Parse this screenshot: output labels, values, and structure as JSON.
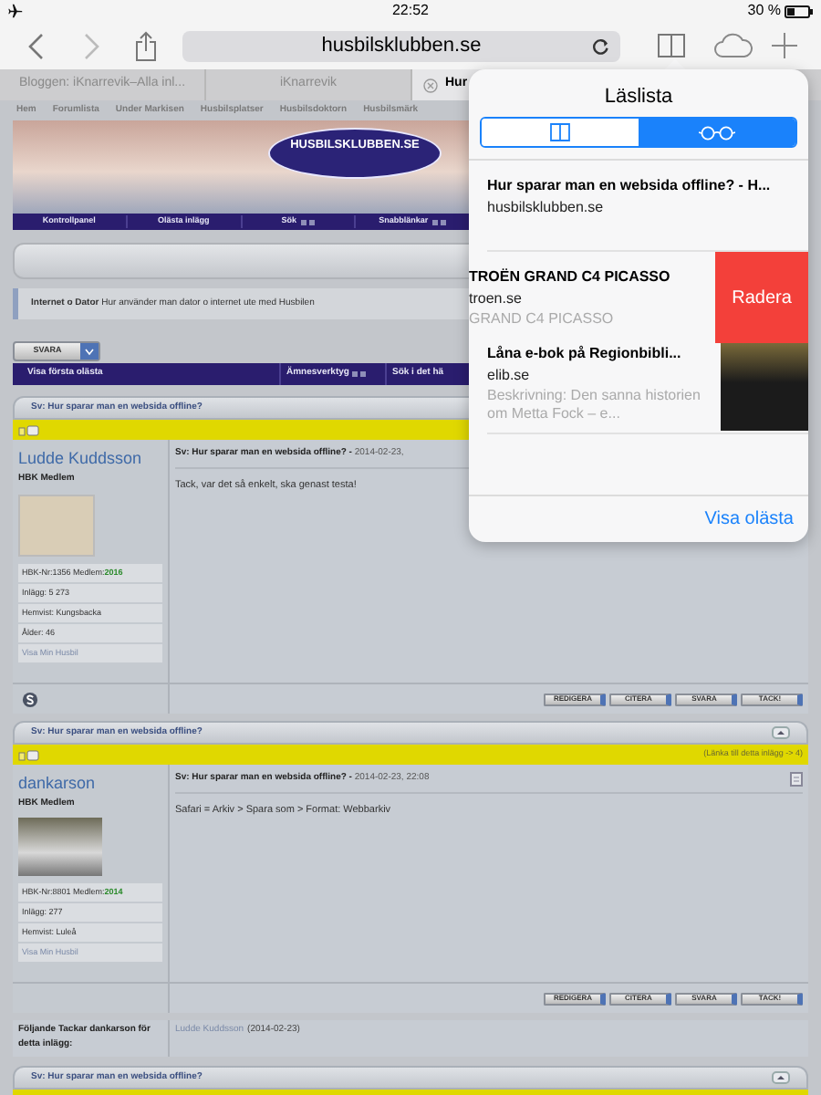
{
  "status_bar": {
    "time": "22:52",
    "battery": "30 %"
  },
  "toolbar": {
    "url": "husbilsklubben.se"
  },
  "tabs": [
    {
      "label": "Bloggen: iKnarrevik–Alla inl...",
      "selected": false
    },
    {
      "label": "iKnarrevik",
      "selected": false
    },
    {
      "label": "Hur",
      "selected": true
    }
  ],
  "site": {
    "menu": [
      "Hem",
      "Forumlista",
      "Under Markisen",
      "Husbilsplatser",
      "Husbilsdoktorn",
      "Husbilsmärk"
    ],
    "logo": "HUSBILSKLUBBEN.SE",
    "nav": [
      {
        "label": "Kontrollpanel",
        "dropdown": false
      },
      {
        "label": "Olästa inlägg",
        "dropdown": false
      },
      {
        "label": "Sök",
        "dropdown": true
      },
      {
        "label": "Snabblänkar",
        "dropdown": true
      }
    ],
    "forum_description": "**Internet o Dator** Hur använder man dator o internet ute med Husbilen",
    "reply_button": "SVARA",
    "thread_tools": [
      {
        "label": "Visa första olästa",
        "dropdown": false
      },
      {
        "label": "Ämnesverktyg",
        "dropdown": true
      },
      {
        "label": "Sök i det hä",
        "dropdown": false
      }
    ]
  },
  "posts": [
    {
      "title": "Sv: Hur sparar man en websida offline?",
      "collapse_button": false,
      "user": "Ludde Kuddsson",
      "rank": "HBK Medlem",
      "avatar": {
        "kind": "cartoon"
      },
      "member_no": "HBK-Nr:1356 Medlem:",
      "member_year": "2016",
      "info": [
        "Inlägg: 5 273",
        "Hemvist: Kungsbacka",
        "Ålder: 46"
      ],
      "profile_link": "Visa Min Husbil",
      "heading": "Sv: Hur sparar man en websida offline? -",
      "date": "2014-02-23,",
      "post_icon": false,
      "body": "Tack, var det så enkelt, ska genast testa!",
      "skype": true,
      "buttons": [
        "REDIGERA",
        "CITERA",
        "SVARA",
        "TACK!"
      ]
    },
    {
      "title": "Sv: Hur sparar man en websida offline?",
      "collapse_button": true,
      "permalink": "(Länka till detta inlägg -> 4)",
      "user": "dankarson",
      "rank": "HBK Medlem",
      "avatar": {
        "kind": "photo"
      },
      "member_no": "HBK-Nr:8801 Medlem:",
      "member_year": "2014",
      "info": [
        "Inlägg: 277",
        "Hemvist: Luleå"
      ],
      "profile_link": "Visa Min Husbil",
      "heading": "Sv: Hur sparar man en websida offline? -",
      "date": "2014-02-23, 22:08",
      "post_icon": true,
      "body": "Safari = Arkiv > Spara som > Format: Webbarkiv",
      "skype": false,
      "buttons": [
        "REDIGERA",
        "CITERA",
        "SVARA",
        "TACK!"
      ]
    }
  ],
  "thanks": {
    "label": "Följande Tackar dankarson för detta inlägg:",
    "user": "Ludde Kuddsson",
    "date": "(2014-02-23)"
  },
  "next_post": {
    "title": "Sv: Hur sparar man en websida offline?",
    "collapse_button": true
  },
  "reading_list": {
    "title": "Läslista",
    "segments": [
      {
        "kind": "book",
        "selected": false
      },
      {
        "kind": "glasses",
        "selected": true
      }
    ],
    "items": [
      {
        "title": "Hur sparar man en websida offline? - H...",
        "domain": "husbilsklubben.se",
        "swiped": false,
        "thumbnail": false
      },
      {
        "title": "TROËN GRAND C4 PICASSO",
        "domain": "troen.se",
        "description": "GRAND C4 PICASSO",
        "swiped": true,
        "thumbnail": false
      },
      {
        "title": "Låna e-bok på Regionbibli...",
        "domain": "elib.se",
        "description": "Beskrivning: Den sanna historien om Metta Fock – e...",
        "swiped": false,
        "thumbnail": true
      }
    ],
    "delete_label": "Radera",
    "footer": "Visa olästa"
  }
}
